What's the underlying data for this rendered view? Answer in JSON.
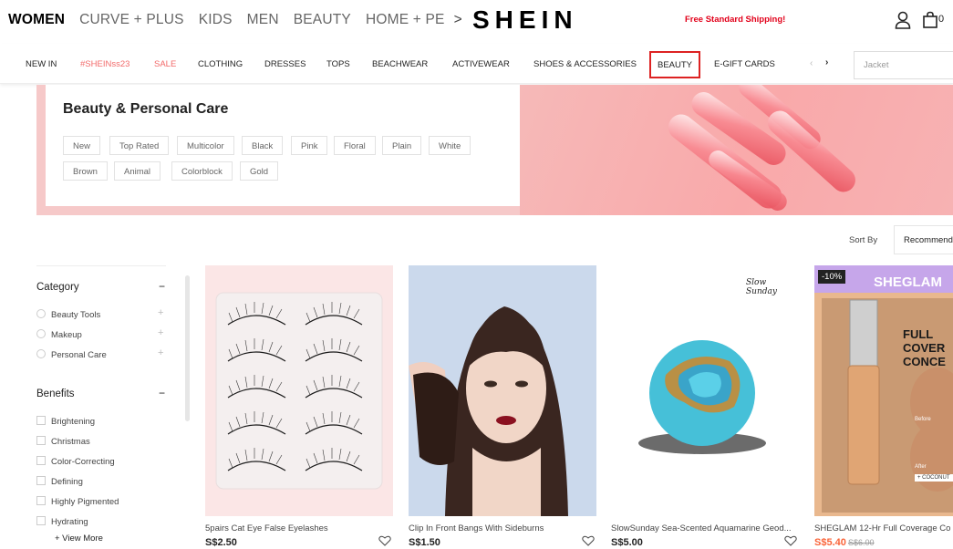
{
  "header": {
    "tabs": [
      "WOMEN",
      "CURVE + PLUS",
      "KIDS",
      "MEN",
      "BEAUTY",
      "HOME + PE"
    ],
    "more_arrow": ">",
    "logo": "SHEIN",
    "promo": "Free Standard Shipping!",
    "bag_count": "0"
  },
  "subnav": {
    "items": [
      "NEW IN",
      "#SHEINss23",
      "SALE",
      "CLOTHING",
      "DRESSES",
      "TOPS",
      "BEACHWEAR",
      "ACTIVEWEAR",
      "SHOES & ACCESSORIES",
      "BEAUTY",
      "E-GIFT CARDS"
    ],
    "search_placeholder": "Jacket"
  },
  "banner": {
    "title": "Beauty & Personal Care",
    "tags": [
      "New",
      "Top Rated",
      "Multicolor",
      "Black",
      "Pink",
      "Floral",
      "Plain",
      "White",
      "Brown",
      "Animal",
      "Colorblock",
      "Gold"
    ]
  },
  "sort": {
    "label": "Sort By",
    "value": "Recommend"
  },
  "filters": {
    "category": {
      "title": "Category",
      "toggle": "−",
      "options": [
        "Beauty Tools",
        "Makeup",
        "Personal Care"
      ]
    },
    "benefits": {
      "title": "Benefits",
      "toggle": "−",
      "options": [
        "Brightening",
        "Christmas",
        "Color-Correcting",
        "Defining",
        "Highly Pigmented",
        "Hydrating"
      ]
    },
    "view_more": "+ View More"
  },
  "products": [
    {
      "name": "5pairs Cat Eye False Eyelashes",
      "price": "S$2.50"
    },
    {
      "name": "Clip In Front Bangs With Sideburns",
      "price": "S$1.50"
    },
    {
      "name": "SlowSunday Sea-Scented Aquamarine Geod...",
      "price": "S$5.00",
      "brand_mark": "Slow Sunday"
    },
    {
      "name": "SHEGLAM 12-Hr Full Coverage Co",
      "price": "S$5.40",
      "old_price": "S$6.00",
      "discount": "-10%",
      "brand": "SHEGLAM",
      "tagline": "FULL COVER CONCE",
      "badge_before": "Before",
      "badge_after": "After",
      "badge_coconut": "+ COCONUT"
    }
  ],
  "colors": {
    "accent": "#e2001a",
    "sale_red": "#fa6338",
    "banner_pink": "#f6c9c9",
    "sheglam_purple": "#c6a6ea"
  }
}
